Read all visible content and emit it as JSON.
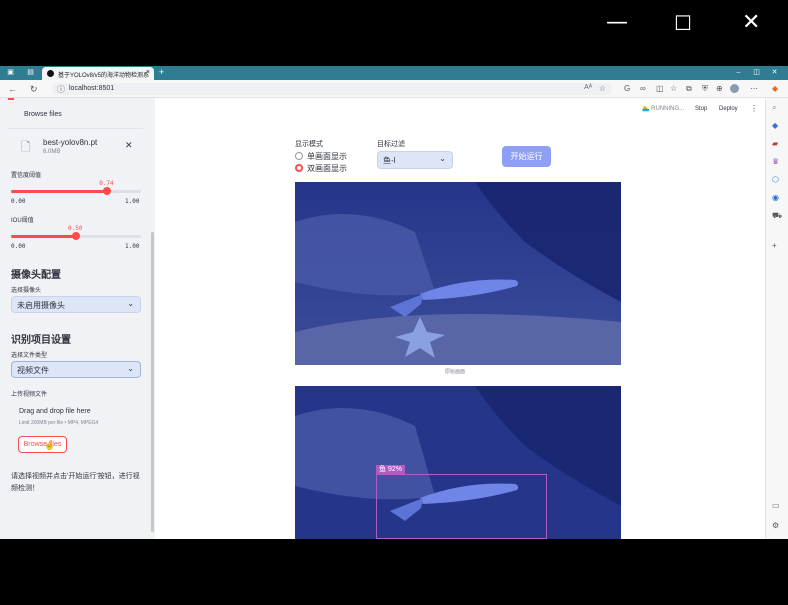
{
  "window": {
    "minimize_glyph": "—",
    "maximize_glyph": "☐",
    "close_glyph": "✕"
  },
  "browser": {
    "tab_title": "基于YOLOv8/v5的海洋动物检测系",
    "tab_close": "×",
    "new_tab": "+",
    "url": "localhost:8501",
    "tabbar_color": "#2f7d93",
    "tabbar_controls": {
      "minimize": "–",
      "restore": "◫",
      "close": "✕"
    }
  },
  "app_header": {
    "running_label": "RUNNING...",
    "stop_label": "Stop",
    "deploy_label": "Deploy",
    "menu_glyph": "⋮"
  },
  "sidebar": {
    "browse_files_top": "Browse files",
    "model_file": {
      "name": "best-yolov8n.pt",
      "size": "6.0MB",
      "remove_glyph": "✕"
    },
    "confidence": {
      "label": "置信度阈值",
      "value": 0.74,
      "value_text": "0.74",
      "min_text": "0.00",
      "max_text": "1.00"
    },
    "iou": {
      "label": "IOU阈值",
      "value": 0.5,
      "value_text": "0.50",
      "min_text": "0.00",
      "max_text": "1.00"
    },
    "camera_section": {
      "heading": "摄像头配置",
      "select_label": "选择摄像头",
      "select_value": "未启用摄像头"
    },
    "recognition_section": {
      "heading": "识别项目设置",
      "file_type_label": "选择文件类型",
      "file_type_value": "视频文件",
      "upload_label": "上传视频文件",
      "dropzone_title": "Drag and drop file here",
      "dropzone_limit": "Limit 200MB per file • MP4, MPEG4",
      "browse_button": "Browse files"
    },
    "hint_text": "请选择视频并点击'开始运行'按钮，进行视频检测！"
  },
  "main": {
    "display_mode": {
      "label": "显示模式",
      "options": [
        "单画面显示",
        "双画面显示"
      ],
      "selected": "双画面显示"
    },
    "target_filter": {
      "label": "目标过滤",
      "value": "鱼-l"
    },
    "start_button": "开始运行",
    "original_caption": "原始画面",
    "detection": {
      "label": "鱼",
      "confidence_text": "92%"
    }
  },
  "colors": {
    "accent": "#ff4b4b",
    "primary_button": "#8f9ff5",
    "select_bg": "#dce6f7",
    "box_color": "#b35bc4"
  }
}
